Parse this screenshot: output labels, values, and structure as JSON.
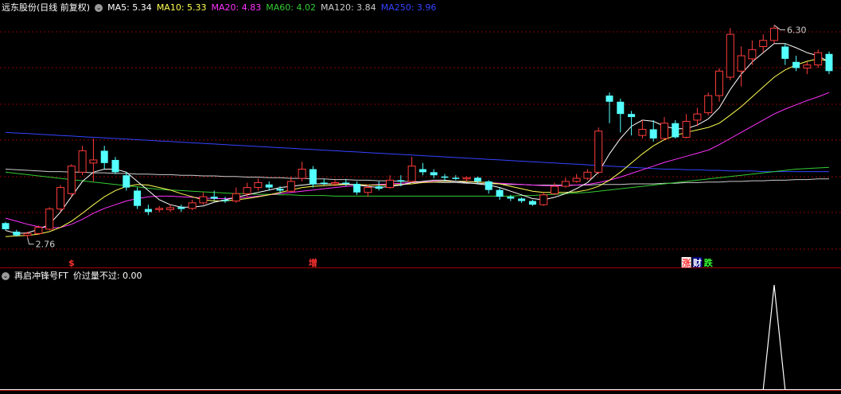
{
  "main_header": {
    "title": "远东股份(日线 前复权)",
    "items": [
      {
        "label": "MA5: 5.34",
        "color": "#ffffff"
      },
      {
        "label": "MA10: 5.33",
        "color": "#ffff54"
      },
      {
        "label": "MA20: 4.83",
        "color": "#ff33ff"
      },
      {
        "label": "MA60: 4.02",
        "color": "#33cc33"
      },
      {
        "label": "MA120: 3.84",
        "color": "#cccccc"
      },
      {
        "label": "MA250: 3.96",
        "color": "#3344ff"
      }
    ]
  },
  "indicator_header": {
    "title": "再启冲锋号FT",
    "items": [
      {
        "label": "价过量不过: 0.00",
        "color": "#ffffff"
      }
    ]
  },
  "price_labels": {
    "high": "6.30",
    "low": "2.76"
  },
  "events": [
    {
      "text": "$",
      "color": "#ff3030"
    },
    {
      "text": "增",
      "color": "#ff3030"
    },
    {
      "text": "涨",
      "color": "#ff3030",
      "bg": "#ffffff"
    },
    {
      "text": "财",
      "color": "#ffffff",
      "bg": "#000080"
    },
    {
      "text": "跌",
      "color": "#33ff33"
    }
  ],
  "colors": {
    "up": "#ff3b3b",
    "down": "#54ffff",
    "grid": "#8b0000",
    "border": "#a00000"
  },
  "chart_data": {
    "type": "candlestick",
    "yrange": [
      2.5,
      6.5
    ],
    "candles": [
      [
        3.12,
        3.02,
        3.14,
        3.0
      ],
      [
        2.98,
        2.92,
        3.01,
        2.9
      ],
      [
        2.92,
        2.95,
        2.98,
        2.88
      ],
      [
        2.95,
        3.05,
        3.08,
        2.93
      ],
      [
        3.02,
        3.35,
        3.38,
        3.0
      ],
      [
        3.35,
        3.7,
        3.74,
        3.3
      ],
      [
        3.6,
        4.05,
        4.08,
        3.55
      ],
      [
        3.95,
        4.3,
        4.38,
        3.9
      ],
      [
        4.1,
        4.15,
        4.5,
        3.8
      ],
      [
        4.3,
        4.1,
        4.38,
        4.0
      ],
      [
        4.15,
        3.95,
        4.2,
        3.92
      ],
      [
        3.9,
        3.7,
        3.95,
        3.65
      ],
      [
        3.65,
        3.4,
        3.7,
        3.35
      ],
      [
        3.35,
        3.3,
        3.42,
        3.25
      ],
      [
        3.34,
        3.36,
        3.4,
        3.3
      ],
      [
        3.34,
        3.37,
        3.42,
        3.3
      ],
      [
        3.38,
        3.35,
        3.42,
        3.3
      ],
      [
        3.36,
        3.45,
        3.5,
        3.33
      ],
      [
        3.45,
        3.55,
        3.62,
        3.42
      ],
      [
        3.55,
        3.52,
        3.65,
        3.48
      ],
      [
        3.5,
        3.48,
        3.55,
        3.45
      ],
      [
        3.48,
        3.6,
        3.7,
        3.45
      ],
      [
        3.6,
        3.7,
        3.78,
        3.55
      ],
      [
        3.7,
        3.78,
        3.85,
        3.65
      ],
      [
        3.75,
        3.7,
        3.8,
        3.65
      ],
      [
        3.68,
        3.65,
        3.72,
        3.6
      ],
      [
        3.64,
        3.8,
        3.88,
        3.62
      ],
      [
        3.85,
        4.0,
        4.12,
        3.8
      ],
      [
        4.0,
        3.75,
        4.05,
        3.7
      ],
      [
        3.78,
        3.76,
        3.84,
        3.74
      ],
      [
        3.76,
        3.78,
        3.82,
        3.72
      ],
      [
        3.78,
        3.76,
        3.84,
        3.72
      ],
      [
        3.76,
        3.62,
        3.8,
        3.58
      ],
      [
        3.62,
        3.7,
        3.75,
        3.55
      ],
      [
        3.72,
        3.68,
        3.8,
        3.65
      ],
      [
        3.7,
        3.82,
        3.9,
        3.68
      ],
      [
        3.82,
        3.8,
        3.9,
        3.72
      ],
      [
        3.8,
        4.05,
        4.2,
        3.78
      ],
      [
        4.0,
        3.95,
        4.1,
        3.9
      ],
      [
        3.95,
        3.9,
        4.0,
        3.85
      ],
      [
        3.88,
        3.86,
        3.92,
        3.8
      ],
      [
        3.86,
        3.84,
        3.9,
        3.82
      ],
      [
        3.84,
        3.86,
        3.88,
        3.8
      ],
      [
        3.86,
        3.8,
        3.88,
        3.76
      ],
      [
        3.8,
        3.66,
        3.82,
        3.6
      ],
      [
        3.66,
        3.55,
        3.7,
        3.5
      ],
      [
        3.55,
        3.52,
        3.58,
        3.48
      ],
      [
        3.52,
        3.48,
        3.54,
        3.45
      ],
      [
        3.48,
        3.42,
        3.5,
        3.4
      ],
      [
        3.42,
        3.58,
        3.62,
        3.4
      ],
      [
        3.6,
        3.72,
        3.78,
        3.58
      ],
      [
        3.72,
        3.8,
        3.86,
        3.7
      ],
      [
        3.8,
        3.85,
        3.92,
        3.78
      ],
      [
        3.85,
        3.95,
        4.0,
        3.82
      ],
      [
        3.95,
        4.62,
        4.68,
        3.92
      ],
      [
        5.2,
        5.1,
        5.25,
        4.75
      ],
      [
        5.1,
        4.9,
        5.15,
        4.6
      ],
      [
        4.9,
        4.85,
        4.95,
        4.55
      ],
      [
        4.55,
        4.65,
        4.8,
        4.5
      ],
      [
        4.65,
        4.5,
        4.8,
        4.45
      ],
      [
        4.5,
        4.75,
        4.85,
        4.48
      ],
      [
        4.75,
        4.52,
        4.8,
        4.5
      ],
      [
        4.52,
        4.78,
        4.9,
        4.5
      ],
      [
        4.8,
        4.9,
        5.0,
        4.7
      ],
      [
        4.92,
        5.2,
        5.25,
        4.88
      ],
      [
        5.2,
        5.6,
        5.65,
        5.1
      ],
      [
        5.5,
        6.2,
        6.3,
        5.45
      ],
      [
        5.6,
        5.85,
        6.0,
        5.35
      ],
      [
        5.8,
        5.95,
        6.1,
        5.7
      ],
      [
        6.0,
        6.1,
        6.2,
        5.9
      ],
      [
        6.1,
        6.3,
        6.35,
        6.05
      ],
      [
        6.0,
        5.8,
        6.05,
        5.7
      ],
      [
        5.75,
        5.65,
        5.85,
        5.6
      ],
      [
        5.65,
        5.7,
        5.75,
        5.55
      ],
      [
        5.7,
        5.9,
        5.95,
        5.65
      ],
      [
        5.88,
        5.6,
        5.92,
        5.55
      ]
    ],
    "ma5": [
      3.0,
      2.95,
      2.96,
      3.02,
      3.1,
      3.3,
      3.55,
      3.8,
      3.95,
      4.0,
      4.0,
      3.95,
      3.8,
      3.65,
      3.5,
      3.42,
      3.38,
      3.38,
      3.4,
      3.46,
      3.5,
      3.54,
      3.58,
      3.62,
      3.66,
      3.7,
      3.72,
      3.74,
      3.76,
      3.76,
      3.76,
      3.76,
      3.74,
      3.72,
      3.7,
      3.72,
      3.74,
      3.78,
      3.8,
      3.82,
      3.82,
      3.8,
      3.78,
      3.76,
      3.74,
      3.7,
      3.64,
      3.58,
      3.52,
      3.5,
      3.54,
      3.6,
      3.68,
      3.78,
      3.95,
      4.25,
      4.5,
      4.7,
      4.8,
      4.78,
      4.7,
      4.66,
      4.66,
      4.72,
      4.82,
      5.0,
      5.3,
      5.55,
      5.75,
      5.9,
      6.05,
      6.05,
      5.98,
      5.9,
      5.85,
      5.75
    ],
    "ma10": [
      2.9,
      2.91,
      2.92,
      2.94,
      2.98,
      3.05,
      3.15,
      3.28,
      3.42,
      3.55,
      3.65,
      3.72,
      3.75,
      3.74,
      3.7,
      3.66,
      3.6,
      3.55,
      3.5,
      3.48,
      3.48,
      3.5,
      3.52,
      3.55,
      3.58,
      3.62,
      3.66,
      3.7,
      3.72,
      3.73,
      3.74,
      3.75,
      3.75,
      3.74,
      3.74,
      3.74,
      3.75,
      3.76,
      3.78,
      3.79,
      3.8,
      3.8,
      3.8,
      3.79,
      3.78,
      3.76,
      3.72,
      3.68,
      3.64,
      3.62,
      3.62,
      3.62,
      3.63,
      3.66,
      3.72,
      3.82,
      3.95,
      4.1,
      4.25,
      4.38,
      4.48,
      4.55,
      4.6,
      4.64,
      4.68,
      4.75,
      4.88,
      5.02,
      5.18,
      5.34,
      5.5,
      5.62,
      5.7,
      5.76,
      5.8,
      5.76
    ],
    "ma20": [
      3.2,
      3.15,
      3.1,
      3.06,
      3.04,
      3.05,
      3.1,
      3.18,
      3.28,
      3.36,
      3.42,
      3.48,
      3.52,
      3.55,
      3.56,
      3.56,
      3.55,
      3.54,
      3.53,
      3.52,
      3.52,
      3.53,
      3.54,
      3.56,
      3.58,
      3.6,
      3.62,
      3.64,
      3.66,
      3.68,
      3.7,
      3.72,
      3.73,
      3.74,
      3.75,
      3.76,
      3.77,
      3.78,
      3.79,
      3.8,
      3.8,
      3.8,
      3.8,
      3.79,
      3.78,
      3.77,
      3.76,
      3.75,
      3.74,
      3.73,
      3.73,
      3.73,
      3.74,
      3.75,
      3.78,
      3.82,
      3.87,
      3.93,
      3.99,
      4.05,
      4.11,
      4.16,
      4.21,
      4.26,
      4.31,
      4.4,
      4.5,
      4.6,
      4.7,
      4.8,
      4.9,
      4.98,
      5.05,
      5.12,
      5.18,
      5.25
    ],
    "ma60": [
      3.95,
      3.93,
      3.91,
      3.89,
      3.87,
      3.85,
      3.83,
      3.81,
      3.79,
      3.77,
      3.75,
      3.73,
      3.71,
      3.69,
      3.67,
      3.66,
      3.65,
      3.64,
      3.63,
      3.62,
      3.61,
      3.6,
      3.6,
      3.59,
      3.59,
      3.58,
      3.58,
      3.57,
      3.57,
      3.57,
      3.56,
      3.56,
      3.56,
      3.56,
      3.56,
      3.56,
      3.56,
      3.56,
      3.56,
      3.56,
      3.56,
      3.56,
      3.56,
      3.56,
      3.56,
      3.56,
      3.56,
      3.57,
      3.57,
      3.58,
      3.59,
      3.6,
      3.61,
      3.62,
      3.64,
      3.66,
      3.68,
      3.7,
      3.72,
      3.74,
      3.76,
      3.78,
      3.8,
      3.82,
      3.84,
      3.86,
      3.88,
      3.9,
      3.92,
      3.94,
      3.96,
      3.98,
      4.0,
      4.01,
      4.02,
      4.03
    ],
    "ma120": [
      4.0,
      3.99,
      3.98,
      3.97,
      3.96,
      3.96,
      3.95,
      3.95,
      3.94,
      3.94,
      3.93,
      3.93,
      3.92,
      3.92,
      3.91,
      3.91,
      3.9,
      3.9,
      3.89,
      3.89,
      3.88,
      3.88,
      3.87,
      3.87,
      3.86,
      3.86,
      3.85,
      3.85,
      3.84,
      3.84,
      3.83,
      3.83,
      3.82,
      3.82,
      3.81,
      3.81,
      3.8,
      3.8,
      3.79,
      3.79,
      3.78,
      3.78,
      3.77,
      3.77,
      3.76,
      3.76,
      3.75,
      3.75,
      3.74,
      3.74,
      3.74,
      3.74,
      3.74,
      3.74,
      3.75,
      3.75,
      3.75,
      3.76,
      3.76,
      3.76,
      3.77,
      3.77,
      3.78,
      3.78,
      3.79,
      3.79,
      3.8,
      3.8,
      3.81,
      3.81,
      3.82,
      3.82,
      3.83,
      3.83,
      3.84,
      3.84
    ],
    "ma250": [
      4.6,
      4.59,
      4.58,
      4.57,
      4.56,
      4.55,
      4.54,
      4.53,
      4.52,
      4.51,
      4.5,
      4.49,
      4.48,
      4.47,
      4.46,
      4.45,
      4.44,
      4.43,
      4.42,
      4.41,
      4.4,
      4.39,
      4.38,
      4.37,
      4.36,
      4.35,
      4.34,
      4.33,
      4.32,
      4.31,
      4.3,
      4.29,
      4.28,
      4.27,
      4.26,
      4.25,
      4.24,
      4.23,
      4.22,
      4.21,
      4.2,
      4.19,
      4.18,
      4.17,
      4.16,
      4.15,
      4.14,
      4.13,
      4.12,
      4.11,
      4.1,
      4.09,
      4.08,
      4.07,
      4.06,
      4.05,
      4.04,
      4.03,
      4.02,
      4.01,
      4.0,
      4.0,
      3.99,
      3.99,
      3.98,
      3.98,
      3.97,
      3.97,
      3.97,
      3.96,
      3.96,
      3.96,
      3.96,
      3.96,
      3.96,
      3.96
    ],
    "signal": [
      0,
      0,
      0,
      0,
      0,
      0,
      0,
      0,
      0,
      0,
      0,
      0,
      0,
      0,
      0,
      0,
      0,
      0,
      0,
      0,
      0,
      0,
      0,
      0,
      0,
      0,
      0,
      0,
      0,
      0,
      0,
      0,
      0,
      0,
      0,
      0,
      0,
      0,
      0,
      0,
      0,
      0,
      0,
      0,
      0,
      0,
      0,
      0,
      0,
      0,
      0,
      0,
      0,
      0,
      0,
      0,
      0,
      0,
      0,
      0,
      0,
      0,
      0,
      0,
      0,
      0,
      0,
      0,
      0,
      0,
      1,
      0,
      0,
      0,
      0,
      0
    ],
    "event_index": [
      6,
      28,
      62,
      63,
      64
    ]
  }
}
